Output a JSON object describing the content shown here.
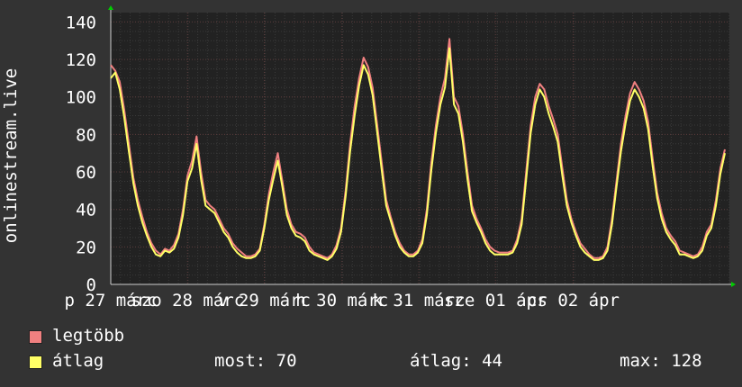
{
  "chart_data": {
    "type": "line",
    "ylabel": "onlinestream.live",
    "ylim": [
      0,
      145
    ],
    "yticks": [
      0,
      20,
      40,
      60,
      80,
      100,
      120,
      140
    ],
    "xlim": [
      0,
      685
    ],
    "xtick_labels": [
      {
        "label": "p 27 márc",
        "x": 0
      },
      {
        "label": "szo 28 márc",
        "x": 85
      },
      {
        "label": "v 29 márc",
        "x": 170
      },
      {
        "label": "h 30 márc",
        "x": 256
      },
      {
        "label": "k 31 márc",
        "x": 341
      },
      {
        "label": "sze 01 ápr",
        "x": 426
      },
      {
        "label": "cs 02 ápr",
        "x": 512
      }
    ],
    "grid": true,
    "colors": {
      "max": "#f08080",
      "avg": "#ffff66",
      "background": "#222222",
      "grid": "#444444",
      "axis": "#cccccc"
    },
    "series": [
      {
        "name": "legtöbb",
        "x": [
          0,
          5,
          10,
          15,
          20,
          25,
          30,
          35,
          40,
          45,
          50,
          55,
          60,
          65,
          70,
          75,
          80,
          85,
          90,
          95,
          100,
          105,
          110,
          115,
          120,
          125,
          130,
          135,
          140,
          145,
          150,
          155,
          160,
          165,
          170,
          175,
          180,
          185,
          190,
          195,
          200,
          205,
          210,
          215,
          220,
          225,
          230,
          235,
          240,
          245,
          250,
          255,
          260,
          265,
          270,
          275,
          280,
          285,
          290,
          295,
          300,
          305,
          310,
          315,
          320,
          325,
          330,
          335,
          340,
          345,
          350,
          355,
          360,
          365,
          370,
          375,
          380,
          385,
          390,
          395,
          400,
          405,
          410,
          415,
          420,
          425,
          430,
          435,
          440,
          445,
          450,
          455,
          460,
          465,
          470,
          475,
          480,
          485,
          490,
          495,
          500,
          505,
          510,
          515,
          520,
          525,
          530,
          535,
          540,
          545,
          550,
          555,
          560,
          565,
          570,
          575,
          580,
          585,
          590,
          595,
          600,
          605,
          610,
          615,
          620,
          625,
          630,
          635,
          640,
          645,
          650,
          655,
          660,
          665,
          670,
          675,
          680
        ],
        "values": [
          117,
          114,
          108,
          93,
          75,
          57,
          45,
          36,
          28,
          22,
          18,
          16,
          19,
          18,
          21,
          27,
          40,
          58,
          66,
          79,
          60,
          45,
          42,
          40,
          35,
          30,
          27,
          22,
          19,
          17,
          15,
          15,
          16,
          19,
          32,
          48,
          60,
          70,
          55,
          40,
          32,
          28,
          27,
          25,
          20,
          17,
          16,
          15,
          14,
          16,
          21,
          30,
          50,
          75,
          95,
          110,
          121,
          116,
          105,
          85,
          65,
          45,
          36,
          28,
          22,
          18,
          16,
          16,
          18,
          24,
          40,
          65,
          85,
          100,
          110,
          131,
          100,
          95,
          80,
          60,
          42,
          35,
          30,
          24,
          20,
          18,
          17,
          17,
          17,
          18,
          24,
          35,
          60,
          85,
          100,
          107,
          104,
          95,
          88,
          80,
          62,
          45,
          35,
          28,
          22,
          19,
          16,
          14,
          14,
          15,
          20,
          35,
          55,
          75,
          90,
          102,
          108,
          104,
          98,
          87,
          67,
          49,
          38,
          30,
          26,
          23,
          18,
          17,
          16,
          15,
          16,
          20,
          28,
          32,
          45,
          62,
          72
        ]
      },
      {
        "name": "átlag",
        "x": [
          0,
          5,
          10,
          15,
          20,
          25,
          30,
          35,
          40,
          45,
          50,
          55,
          60,
          65,
          70,
          75,
          80,
          85,
          90,
          95,
          100,
          105,
          110,
          115,
          120,
          125,
          130,
          135,
          140,
          145,
          150,
          155,
          160,
          165,
          170,
          175,
          180,
          185,
          190,
          195,
          200,
          205,
          210,
          215,
          220,
          225,
          230,
          235,
          240,
          245,
          250,
          255,
          260,
          265,
          270,
          275,
          280,
          285,
          290,
          295,
          300,
          305,
          310,
          315,
          320,
          325,
          330,
          335,
          340,
          345,
          350,
          355,
          360,
          365,
          370,
          375,
          380,
          385,
          390,
          395,
          400,
          405,
          410,
          415,
          420,
          425,
          430,
          435,
          440,
          445,
          450,
          455,
          460,
          465,
          470,
          475,
          480,
          485,
          490,
          495,
          500,
          505,
          510,
          515,
          520,
          525,
          530,
          535,
          540,
          545,
          550,
          555,
          560,
          565,
          570,
          575,
          580,
          585,
          590,
          595,
          600,
          605,
          610,
          615,
          620,
          625,
          630,
          635,
          640,
          645,
          650,
          655,
          660,
          665,
          670,
          675,
          680
        ],
        "values": [
          110,
          113,
          104,
          89,
          71,
          54,
          42,
          33,
          26,
          20,
          16,
          15,
          18,
          17,
          19,
          25,
          37,
          55,
          62,
          75,
          56,
          42,
          40,
          38,
          33,
          28,
          25,
          20,
          17,
          15,
          14,
          14,
          15,
          18,
          30,
          45,
          56,
          66,
          52,
          37,
          30,
          26,
          25,
          23,
          18,
          16,
          15,
          14,
          13,
          15,
          19,
          28,
          47,
          71,
          90,
          106,
          117,
          112,
          101,
          81,
          61,
          42,
          34,
          26,
          20,
          17,
          15,
          15,
          17,
          22,
          37,
          61,
          81,
          96,
          105,
          126,
          96,
          91,
          76,
          56,
          39,
          33,
          28,
          22,
          18,
          16,
          16,
          16,
          16,
          17,
          22,
          32,
          56,
          81,
          96,
          104,
          100,
          91,
          84,
          76,
          58,
          42,
          33,
          26,
          20,
          17,
          15,
          13,
          13,
          14,
          18,
          32,
          52,
          71,
          86,
          98,
          104,
          100,
          94,
          83,
          63,
          46,
          35,
          28,
          24,
          21,
          16,
          16,
          15,
          14,
          15,
          18,
          26,
          30,
          42,
          59,
          70
        ]
      }
    ]
  },
  "legend": {
    "max_label": "legtöbb",
    "avg_label": "átlag"
  },
  "stats": {
    "now": "most: 70",
    "avg": "átlag: 44",
    "max": "max: 128"
  }
}
